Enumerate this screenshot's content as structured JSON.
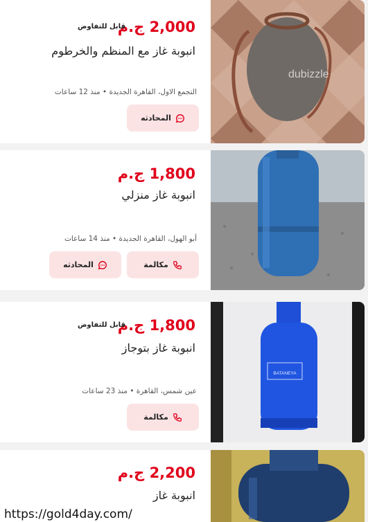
{
  "listings": [
    {
      "price": "2,000",
      "currency": "ج.م",
      "negotiable": "قابل للتفاوض",
      "title": "انبوبة غاز مع المنظم والخرطوم",
      "location": "التجمع الاول، القاهرة الجديدة • منذ 12 ساعات",
      "buttons": [
        "المحادثه"
      ],
      "image_watermark": "dubizzle"
    },
    {
      "price": "1,800",
      "currency": "ج.م",
      "title": "انبوبة غاز منزلي",
      "location": "أبو الهول، القاهرة الجديدة • منذ 14 ساعات",
      "buttons": [
        "مكالمة",
        "المحادثه"
      ]
    },
    {
      "price": "1,800",
      "currency": "ج.م",
      "negotiable": "قابل للتفاوض",
      "title": "انبوبة غاز بتوجاز",
      "location": "عين شمس، القاهرة • منذ 23 ساعات",
      "buttons": [
        "مكالمة"
      ],
      "image_label": "BATANEYA"
    },
    {
      "price": "2,200",
      "currency": "ج.م",
      "title": "انبوبة غاز"
    }
  ],
  "overlay_url": "https://gold4day.com/",
  "colors": {
    "price": "#e0001b",
    "button_bg": "#fbe3e4",
    "icon": "#e0001b"
  }
}
